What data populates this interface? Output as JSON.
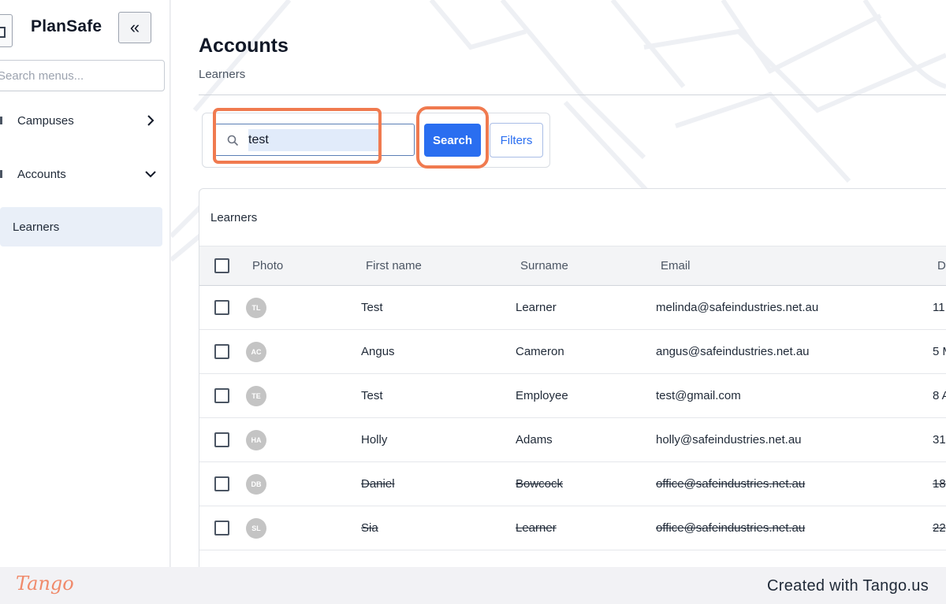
{
  "app": {
    "brand": "PlanSafe",
    "collapse_label": "«"
  },
  "sidebar": {
    "search_placeholder": "Search menus...",
    "items": [
      {
        "label": "Campuses",
        "chevron": "chevron-right"
      },
      {
        "label": "Accounts",
        "chevron": "chevron-down"
      },
      {
        "label": "Learners",
        "active": true
      }
    ]
  },
  "page": {
    "title": "Accounts",
    "breadcrumb": "Learners"
  },
  "search": {
    "value": "test",
    "button_label": "Search",
    "filters_label": "Filters"
  },
  "table": {
    "caption": "Learners",
    "columns": [
      "Photo",
      "First name",
      "Surname",
      "Email",
      "D"
    ],
    "rows": [
      {
        "initials": "TL",
        "first": "Test",
        "surname": "Learner",
        "email": "melinda@safeindustries.net.au",
        "date": "11",
        "struck": false
      },
      {
        "initials": "AC",
        "first": "Angus",
        "surname": "Cameron",
        "email": "angus@safeindustries.net.au",
        "date": "5 M",
        "struck": false
      },
      {
        "initials": "TE",
        "first": "Test",
        "surname": "Employee",
        "email": "test@gmail.com",
        "date": "8 A",
        "struck": false
      },
      {
        "initials": "HA",
        "first": "Holly",
        "surname": "Adams",
        "email": "holly@safeindustries.net.au",
        "date": "31",
        "struck": false
      },
      {
        "initials": "DB",
        "first": "Daniel",
        "surname": "Bowcock",
        "email": "office@safeindustries.net.au",
        "date": "18",
        "struck": true
      },
      {
        "initials": "SL",
        "first": "Sia",
        "surname": "Learner",
        "email": "office@safeindustries.net.au",
        "date": "22",
        "struck": true
      }
    ]
  },
  "footer": {
    "logo": "Tango",
    "credit": "Created with Tango.us"
  },
  "colors": {
    "accent": "#2a6ef0",
    "highlight": "#f07a4f",
    "active_nav": "#e9eff8"
  }
}
